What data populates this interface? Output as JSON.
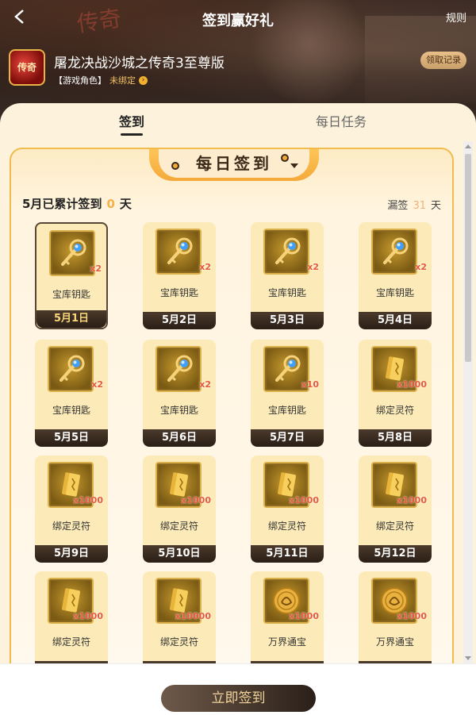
{
  "header": {
    "title": "签到赢好礼",
    "rules_label": "规则",
    "game_name": "屠龙决战沙城之传奇3至尊版",
    "role_label": "【游戏角色】",
    "role_status": "未绑定",
    "claim_records_label": "领取记录"
  },
  "tabs": [
    {
      "label": "签到",
      "active": true
    },
    {
      "label": "每日任务",
      "active": false
    }
  ],
  "card": {
    "banner_title": "每日签到",
    "summary_prefix": "5月已累计签到",
    "summary_count": "0",
    "summary_suffix": "天",
    "missed_label": "漏签",
    "missed_count": "31",
    "missed_suffix": "天"
  },
  "items": [
    {
      "name": "宝库钥匙",
      "qty": "x2",
      "date": "5月1日",
      "icon": "key-icon",
      "selected": true
    },
    {
      "name": "宝库钥匙",
      "qty": "x2",
      "date": "5月2日",
      "icon": "key-icon"
    },
    {
      "name": "宝库钥匙",
      "qty": "x2",
      "date": "5月3日",
      "icon": "key-icon"
    },
    {
      "name": "宝库钥匙",
      "qty": "x2",
      "date": "5月4日",
      "icon": "key-icon"
    },
    {
      "name": "宝库钥匙",
      "qty": "x2",
      "date": "5月5日",
      "icon": "key-icon"
    },
    {
      "name": "宝库钥匙",
      "qty": "x2",
      "date": "5月6日",
      "icon": "key-icon"
    },
    {
      "name": "宝库钥匙",
      "qty": "x10",
      "date": "5月7日",
      "icon": "key-icon"
    },
    {
      "name": "绑定灵符",
      "qty": "x1000",
      "date": "5月8日",
      "icon": "talisman-icon"
    },
    {
      "name": "绑定灵符",
      "qty": "x1000",
      "date": "5月9日",
      "icon": "talisman-icon"
    },
    {
      "name": "绑定灵符",
      "qty": "x1000",
      "date": "5月10日",
      "icon": "talisman-icon"
    },
    {
      "name": "绑定灵符",
      "qty": "x1000",
      "date": "5月11日",
      "icon": "talisman-icon"
    },
    {
      "name": "绑定灵符",
      "qty": "x1000",
      "date": "5月12日",
      "icon": "talisman-icon"
    },
    {
      "name": "绑定灵符",
      "qty": "x1000",
      "date": "",
      "icon": "talisman-icon"
    },
    {
      "name": "绑定灵符",
      "qty": "x10000",
      "date": "",
      "icon": "talisman-icon"
    },
    {
      "name": "万界通宝",
      "qty": "x1000",
      "date": "",
      "icon": "coin-icon"
    },
    {
      "name": "万界通宝",
      "qty": "x1000",
      "date": "",
      "icon": "coin-icon"
    }
  ],
  "footer": {
    "signin_label": "立即签到"
  },
  "colors": {
    "accent": "#f5b14a",
    "panel_bg": "#fdf3dc",
    "card_border": "#f1bc4e",
    "date_bar": "#2a1e16",
    "qty_red": "#e6593b"
  }
}
